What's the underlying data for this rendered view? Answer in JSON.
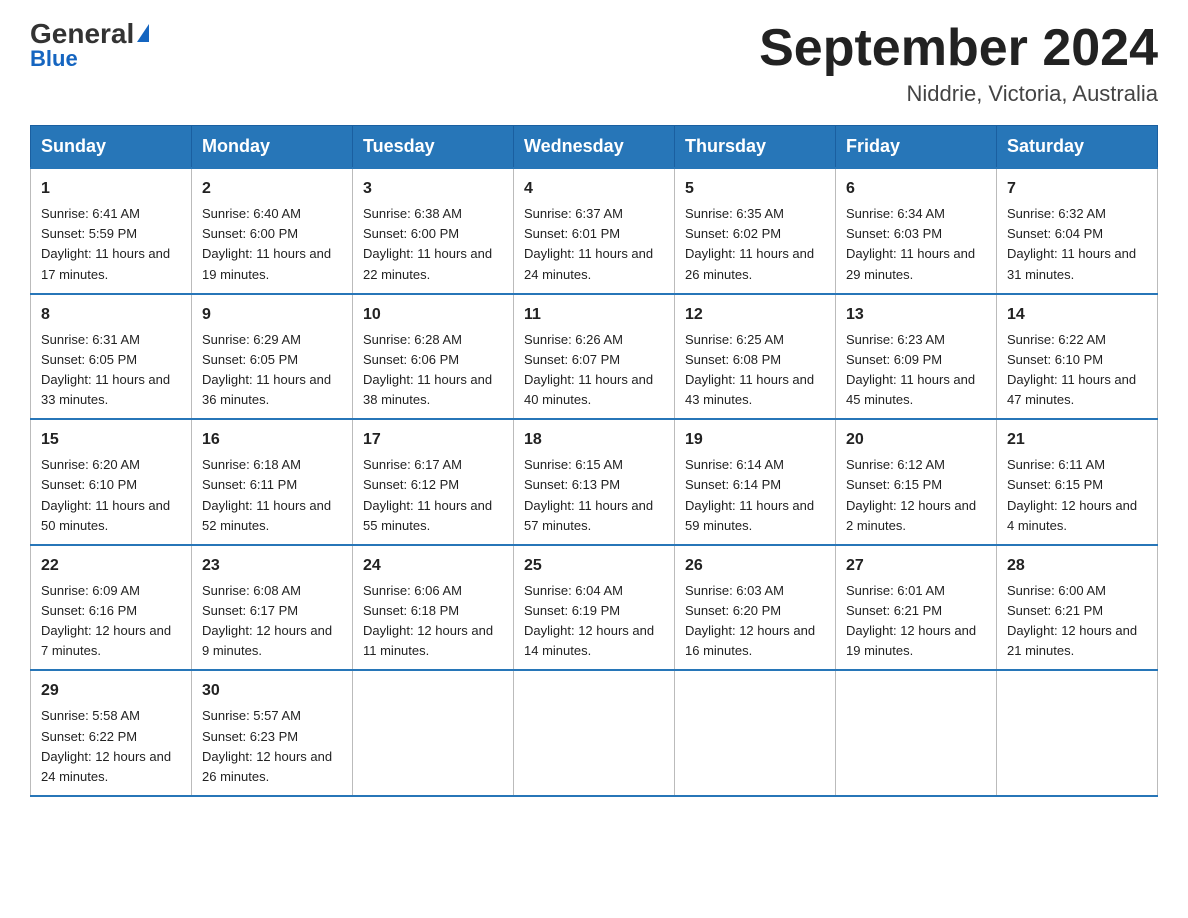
{
  "header": {
    "logo": {
      "general": "General",
      "triangle": "",
      "blue": "Blue"
    },
    "month_title": "September 2024",
    "location": "Niddrie, Victoria, Australia"
  },
  "weekdays": [
    "Sunday",
    "Monday",
    "Tuesday",
    "Wednesday",
    "Thursday",
    "Friday",
    "Saturday"
  ],
  "weeks": [
    [
      {
        "day": "1",
        "sunrise": "6:41 AM",
        "sunset": "5:59 PM",
        "daylight": "11 hours and 17 minutes."
      },
      {
        "day": "2",
        "sunrise": "6:40 AM",
        "sunset": "6:00 PM",
        "daylight": "11 hours and 19 minutes."
      },
      {
        "day": "3",
        "sunrise": "6:38 AM",
        "sunset": "6:00 PM",
        "daylight": "11 hours and 22 minutes."
      },
      {
        "day": "4",
        "sunrise": "6:37 AM",
        "sunset": "6:01 PM",
        "daylight": "11 hours and 24 minutes."
      },
      {
        "day": "5",
        "sunrise": "6:35 AM",
        "sunset": "6:02 PM",
        "daylight": "11 hours and 26 minutes."
      },
      {
        "day": "6",
        "sunrise": "6:34 AM",
        "sunset": "6:03 PM",
        "daylight": "11 hours and 29 minutes."
      },
      {
        "day": "7",
        "sunrise": "6:32 AM",
        "sunset": "6:04 PM",
        "daylight": "11 hours and 31 minutes."
      }
    ],
    [
      {
        "day": "8",
        "sunrise": "6:31 AM",
        "sunset": "6:05 PM",
        "daylight": "11 hours and 33 minutes."
      },
      {
        "day": "9",
        "sunrise": "6:29 AM",
        "sunset": "6:05 PM",
        "daylight": "11 hours and 36 minutes."
      },
      {
        "day": "10",
        "sunrise": "6:28 AM",
        "sunset": "6:06 PM",
        "daylight": "11 hours and 38 minutes."
      },
      {
        "day": "11",
        "sunrise": "6:26 AM",
        "sunset": "6:07 PM",
        "daylight": "11 hours and 40 minutes."
      },
      {
        "day": "12",
        "sunrise": "6:25 AM",
        "sunset": "6:08 PM",
        "daylight": "11 hours and 43 minutes."
      },
      {
        "day": "13",
        "sunrise": "6:23 AM",
        "sunset": "6:09 PM",
        "daylight": "11 hours and 45 minutes."
      },
      {
        "day": "14",
        "sunrise": "6:22 AM",
        "sunset": "6:10 PM",
        "daylight": "11 hours and 47 minutes."
      }
    ],
    [
      {
        "day": "15",
        "sunrise": "6:20 AM",
        "sunset": "6:10 PM",
        "daylight": "11 hours and 50 minutes."
      },
      {
        "day": "16",
        "sunrise": "6:18 AM",
        "sunset": "6:11 PM",
        "daylight": "11 hours and 52 minutes."
      },
      {
        "day": "17",
        "sunrise": "6:17 AM",
        "sunset": "6:12 PM",
        "daylight": "11 hours and 55 minutes."
      },
      {
        "day": "18",
        "sunrise": "6:15 AM",
        "sunset": "6:13 PM",
        "daylight": "11 hours and 57 minutes."
      },
      {
        "day": "19",
        "sunrise": "6:14 AM",
        "sunset": "6:14 PM",
        "daylight": "11 hours and 59 minutes."
      },
      {
        "day": "20",
        "sunrise": "6:12 AM",
        "sunset": "6:15 PM",
        "daylight": "12 hours and 2 minutes."
      },
      {
        "day": "21",
        "sunrise": "6:11 AM",
        "sunset": "6:15 PM",
        "daylight": "12 hours and 4 minutes."
      }
    ],
    [
      {
        "day": "22",
        "sunrise": "6:09 AM",
        "sunset": "6:16 PM",
        "daylight": "12 hours and 7 minutes."
      },
      {
        "day": "23",
        "sunrise": "6:08 AM",
        "sunset": "6:17 PM",
        "daylight": "12 hours and 9 minutes."
      },
      {
        "day": "24",
        "sunrise": "6:06 AM",
        "sunset": "6:18 PM",
        "daylight": "12 hours and 11 minutes."
      },
      {
        "day": "25",
        "sunrise": "6:04 AM",
        "sunset": "6:19 PM",
        "daylight": "12 hours and 14 minutes."
      },
      {
        "day": "26",
        "sunrise": "6:03 AM",
        "sunset": "6:20 PM",
        "daylight": "12 hours and 16 minutes."
      },
      {
        "day": "27",
        "sunrise": "6:01 AM",
        "sunset": "6:21 PM",
        "daylight": "12 hours and 19 minutes."
      },
      {
        "day": "28",
        "sunrise": "6:00 AM",
        "sunset": "6:21 PM",
        "daylight": "12 hours and 21 minutes."
      }
    ],
    [
      {
        "day": "29",
        "sunrise": "5:58 AM",
        "sunset": "6:22 PM",
        "daylight": "12 hours and 24 minutes."
      },
      {
        "day": "30",
        "sunrise": "5:57 AM",
        "sunset": "6:23 PM",
        "daylight": "12 hours and 26 minutes."
      },
      null,
      null,
      null,
      null,
      null
    ]
  ]
}
